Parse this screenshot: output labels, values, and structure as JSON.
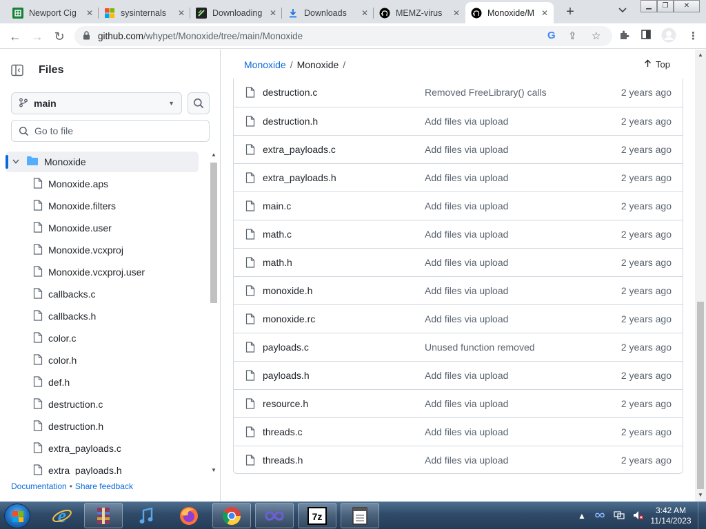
{
  "browser": {
    "tabs": [
      {
        "title": "Newport Cig",
        "icon": "sheets-icon",
        "color": "#188038"
      },
      {
        "title": "sysinternals",
        "icon": "microsoft-icon",
        "color": "#f25022"
      },
      {
        "title": "Downloading",
        "icon": "download-page-icon",
        "color": "#222222"
      },
      {
        "title": "Downloads",
        "icon": "download-icon",
        "color": "#1a73e8"
      },
      {
        "title": "MEMZ-virus",
        "icon": "github-icon",
        "color": "#000000"
      },
      {
        "title": "Monoxide/M",
        "icon": "github-icon",
        "color": "#000000"
      }
    ],
    "address": {
      "host": "github.com",
      "path": "/whypet/Monoxide/tree/main/Monoxide"
    }
  },
  "sidebar": {
    "title": "Files",
    "branch": "main",
    "goto_placeholder": "Go to file",
    "root_folder": "Monoxide",
    "tree_items": [
      "Monoxide.aps",
      "Monoxide.filters",
      "Monoxide.user",
      "Monoxide.vcxproj",
      "Monoxide.vcxproj.user",
      "callbacks.c",
      "callbacks.h",
      "color.c",
      "color.h",
      "def.h",
      "destruction.c",
      "destruction.h",
      "extra_payloads.c",
      "extra_payloads.h"
    ],
    "footer": {
      "documentation": "Documentation",
      "share_feedback": "Share feedback",
      "separator": "•"
    }
  },
  "main": {
    "breadcrumb": {
      "repo": "Monoxide",
      "separator": "/",
      "current": "Monoxide",
      "trailing": "/"
    },
    "top_label": "Top",
    "files": [
      {
        "name": "destruction.c",
        "message": "Removed FreeLibrary() calls",
        "age": "2 years ago"
      },
      {
        "name": "destruction.h",
        "message": "Add files via upload",
        "age": "2 years ago"
      },
      {
        "name": "extra_payloads.c",
        "message": "Add files via upload",
        "age": "2 years ago"
      },
      {
        "name": "extra_payloads.h",
        "message": "Add files via upload",
        "age": "2 years ago"
      },
      {
        "name": "main.c",
        "message": "Add files via upload",
        "age": "2 years ago"
      },
      {
        "name": "math.c",
        "message": "Add files via upload",
        "age": "2 years ago"
      },
      {
        "name": "math.h",
        "message": "Add files via upload",
        "age": "2 years ago"
      },
      {
        "name": "monoxide.h",
        "message": "Add files via upload",
        "age": "2 years ago"
      },
      {
        "name": "monoxide.rc",
        "message": "Add files via upload",
        "age": "2 years ago"
      },
      {
        "name": "payloads.c",
        "message": "Unused function removed",
        "age": "2 years ago"
      },
      {
        "name": "payloads.h",
        "message": "Add files via upload",
        "age": "2 years ago"
      },
      {
        "name": "resource.h",
        "message": "Add files via upload",
        "age": "2 years ago"
      },
      {
        "name": "threads.c",
        "message": "Add files via upload",
        "age": "2 years ago"
      },
      {
        "name": "threads.h",
        "message": "Add files via upload",
        "age": "2 years ago"
      }
    ]
  },
  "taskbar": {
    "apps": [
      {
        "name": "internet-explorer-icon"
      },
      {
        "name": "winrar-icon"
      },
      {
        "name": "itunes-icon"
      },
      {
        "name": "firefox-icon"
      },
      {
        "name": "chrome-icon"
      },
      {
        "name": "infinity-app-icon"
      },
      {
        "name": "7zip-icon",
        "label": "7z"
      },
      {
        "name": "notepad-app-icon"
      }
    ],
    "time": "3:42 AM",
    "date": "11/14/2023"
  },
  "colors": {
    "link": "#0969da",
    "border": "#d0d7de",
    "muted": "#59636e",
    "text": "#1f2328"
  }
}
